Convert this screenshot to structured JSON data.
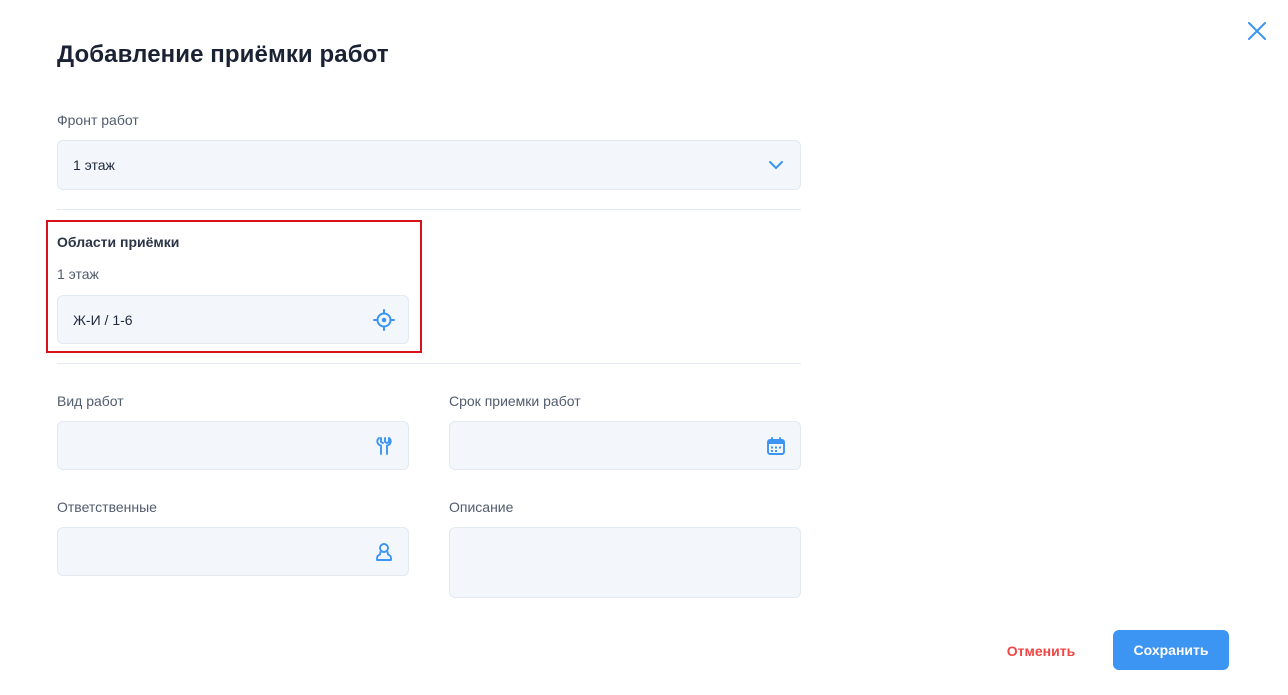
{
  "dialog": {
    "title": "Добавление приёмки работ",
    "close_icon": "close-icon"
  },
  "front": {
    "label": "Фронт работ",
    "value": "1 этаж",
    "icon": "chevron-down-icon"
  },
  "areas": {
    "title": "Области приёмки",
    "group_label": "1 этаж",
    "value": "Ж-И / 1-6",
    "icon": "target-icon"
  },
  "work_type": {
    "label": "Вид работ",
    "value": "",
    "icon": "wrench-icon"
  },
  "deadline": {
    "label": "Срок приемки работ",
    "value": "",
    "icon": "calendar-icon"
  },
  "responsible": {
    "label": "Ответственные",
    "value": "",
    "icon": "user-icon"
  },
  "description": {
    "label": "Описание",
    "value": ""
  },
  "actions": {
    "cancel_label": "Отменить",
    "save_label": "Сохранить"
  },
  "colors": {
    "accent": "#3c94f3",
    "danger": "#f04646",
    "highlight": "#d7121b",
    "field_bg": "#f3f7fb"
  }
}
